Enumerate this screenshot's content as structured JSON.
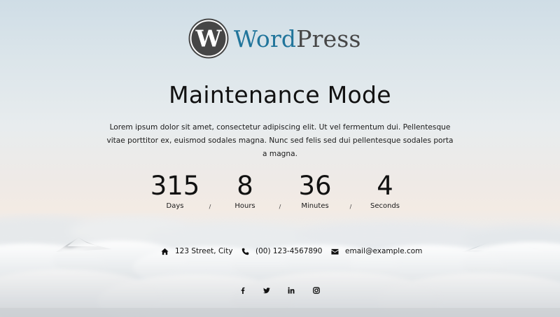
{
  "logo": {
    "word_part1": "Word",
    "word_part2": "Press",
    "brand_color": "#21759b",
    "dark_color": "#464646"
  },
  "title": "Maintenance Mode",
  "description": "Lorem ipsum dolor sit amet, consectetur adipiscing elit. Ut vel fermentum dui. Pellentesque vitae porttitor ex, euismod sodales magna. Nunc sed felis sed dui pellentesque sodales porta a magna.",
  "countdown": {
    "units": [
      {
        "value": "315",
        "label": "Days"
      },
      {
        "value": "8",
        "label": "Hours"
      },
      {
        "value": "36",
        "label": "Minutes"
      },
      {
        "value": "4",
        "label": "Seconds"
      }
    ],
    "separator": "/"
  },
  "contact": {
    "address": {
      "icon": "home-icon",
      "text": "123 Street, City"
    },
    "phone": {
      "icon": "phone-icon",
      "text": "(00) 123-4567890"
    },
    "email": {
      "icon": "envelope-icon",
      "text": "email@example.com"
    }
  },
  "social": [
    {
      "icon": "facebook-icon"
    },
    {
      "icon": "twitter-icon"
    },
    {
      "icon": "linkedin-icon"
    },
    {
      "icon": "instagram-icon"
    }
  ]
}
